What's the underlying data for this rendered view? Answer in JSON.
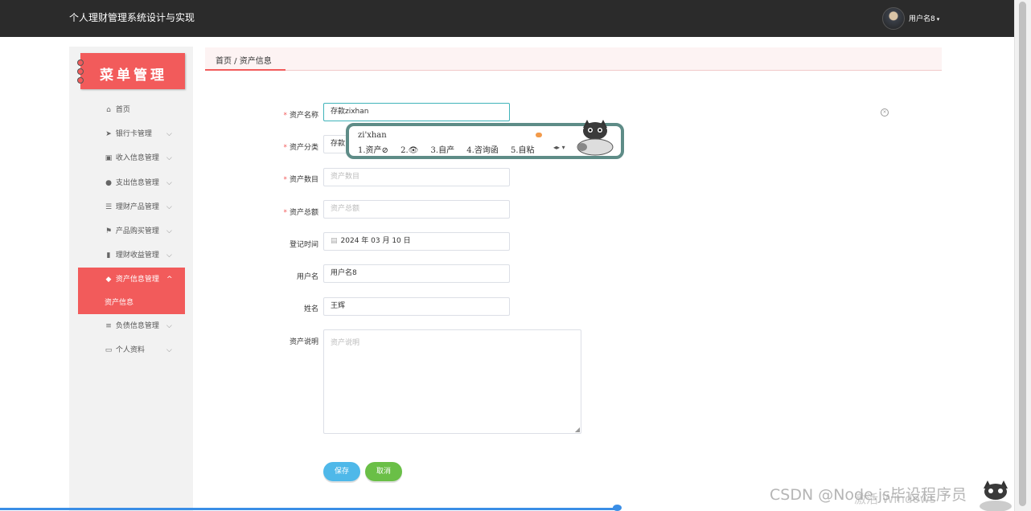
{
  "app": {
    "title": "个人理财管理系统设计与实现"
  },
  "user": {
    "name": "用户名8",
    "caret": "▾"
  },
  "sidebar": {
    "banner_title": "菜单管理",
    "items": [
      {
        "icon": "home-icon",
        "glyph": "⌂",
        "label": "首页",
        "expandable": false
      },
      {
        "icon": "send-icon",
        "glyph": "➤",
        "label": "银行卡管理",
        "expandable": true
      },
      {
        "icon": "briefcase-icon",
        "glyph": "▣",
        "label": "收入信息管理",
        "expandable": true
      },
      {
        "icon": "user-icon",
        "glyph": "●",
        "label": "支出信息管理",
        "expandable": true
      },
      {
        "icon": "sliders-icon",
        "glyph": "☰",
        "label": "理财产品管理",
        "expandable": true
      },
      {
        "icon": "flag-icon",
        "glyph": "⚑",
        "label": "产品购买管理",
        "expandable": true
      },
      {
        "icon": "bar-chart-icon",
        "glyph": "▮",
        "label": "理财收益管理",
        "expandable": true
      },
      {
        "icon": "wallet-icon",
        "glyph": "◆",
        "label": "资产信息管理",
        "expandable": true,
        "active": true,
        "sub": [
          "资产信息"
        ]
      },
      {
        "icon": "list-icon",
        "glyph": "≡",
        "label": "负债信息管理",
        "expandable": true
      },
      {
        "icon": "id-card-icon",
        "glyph": "▭",
        "label": "个人资料",
        "expandable": true
      }
    ]
  },
  "breadcrumb": "首页 / 资产信息",
  "form": {
    "asset_name": {
      "label": "资产名称",
      "required": true,
      "value": "存款zixhan"
    },
    "asset_category": {
      "label": "资产分类",
      "required": true,
      "value": "存款"
    },
    "asset_quantity": {
      "label": "资产数目",
      "required": true,
      "placeholder": "资产数目"
    },
    "asset_total": {
      "label": "资产总额",
      "required": true,
      "placeholder": "资产总额"
    },
    "register_time": {
      "label": "登记时间",
      "required": false,
      "value": "2024 年 03 月 10 日"
    },
    "username": {
      "label": "用户名",
      "required": false,
      "value": "用户名8"
    },
    "realname": {
      "label": "姓名",
      "required": false,
      "value": "王辉"
    },
    "description": {
      "label": "资产说明",
      "required": false,
      "placeholder": "资产说明"
    },
    "save_label": "保存",
    "cancel_label": "取消"
  },
  "ime": {
    "pinyin": "zi'xhan",
    "candidates": [
      "1.资产⊘",
      "2.👁",
      "3.自产",
      "4.咨询函",
      "5.自粘"
    ],
    "pager": "◂▸ ▾"
  },
  "watermark": {
    "text": "CSDN @Node.js毕设程序员",
    "overlay": "激活 Windows"
  },
  "colors": {
    "accent": "#f25b5b",
    "topbar": "#2b2b2b",
    "save": "#4fb8e9",
    "cancel": "#6abf47",
    "focus": "#40b3ba"
  }
}
